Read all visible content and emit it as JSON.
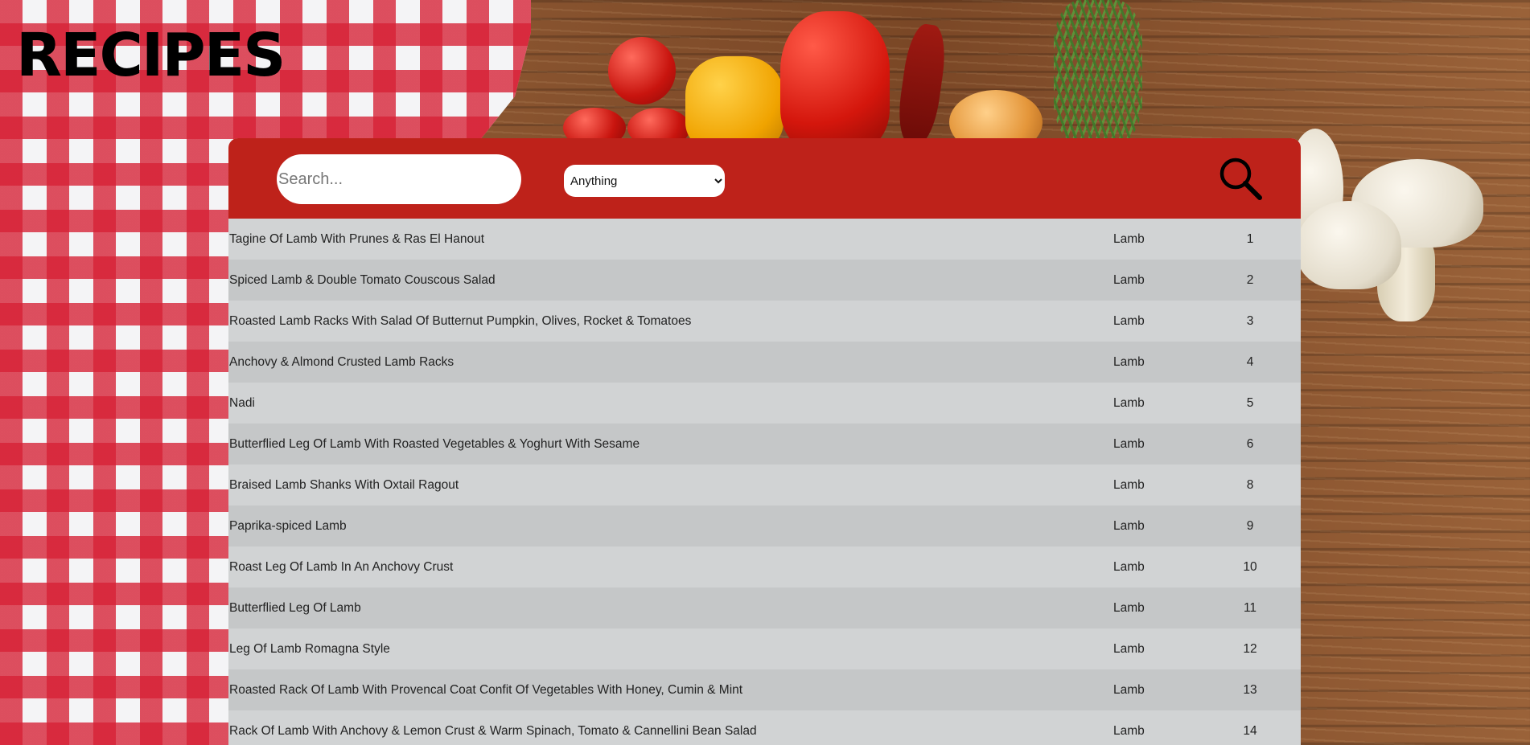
{
  "header": {
    "title": "RECIPES"
  },
  "search": {
    "placeholder": "Search...",
    "value": "",
    "filter_selected": "Anything",
    "search_icon": "magnifier-icon"
  },
  "recipes": [
    {
      "name": "Tagine Of Lamb With Prunes & Ras El Hanout",
      "category": "Lamb",
      "id": "1"
    },
    {
      "name": "Spiced Lamb & Double Tomato Couscous Salad",
      "category": "Lamb",
      "id": "2"
    },
    {
      "name": "Roasted Lamb Racks With Salad Of Butternut Pumpkin, Olives, Rocket & Tomatoes",
      "category": "Lamb",
      "id": "3"
    },
    {
      "name": "Anchovy & Almond Crusted Lamb Racks",
      "category": "Lamb",
      "id": "4"
    },
    {
      "name": "Nadi",
      "category": "Lamb",
      "id": "5"
    },
    {
      "name": "Butterflied Leg Of Lamb With Roasted Vegetables & Yoghurt With Sesame",
      "category": "Lamb",
      "id": "6"
    },
    {
      "name": "Braised Lamb Shanks With Oxtail Ragout",
      "category": "Lamb",
      "id": "8"
    },
    {
      "name": "Paprika-spiced Lamb",
      "category": "Lamb",
      "id": "9"
    },
    {
      "name": "Roast Leg Of Lamb In An Anchovy Crust",
      "category": "Lamb",
      "id": "10"
    },
    {
      "name": "Butterflied Leg Of Lamb",
      "category": "Lamb",
      "id": "11"
    },
    {
      "name": "Leg Of Lamb Romagna Style",
      "category": "Lamb",
      "id": "12"
    },
    {
      "name": "Roasted Rack Of Lamb With Provencal Coat Confit Of Vegetables With Honey, Cumin & Mint",
      "category": "Lamb",
      "id": "13"
    },
    {
      "name": "Rack Of Lamb With Anchovy & Lemon Crust & Warm Spinach, Tomato & Cannellini Bean Salad",
      "category": "Lamb",
      "id": "14"
    }
  ],
  "colors": {
    "accent": "#be221a",
    "row_odd": "#d1d3d4",
    "row_even": "#c5c7c8"
  }
}
